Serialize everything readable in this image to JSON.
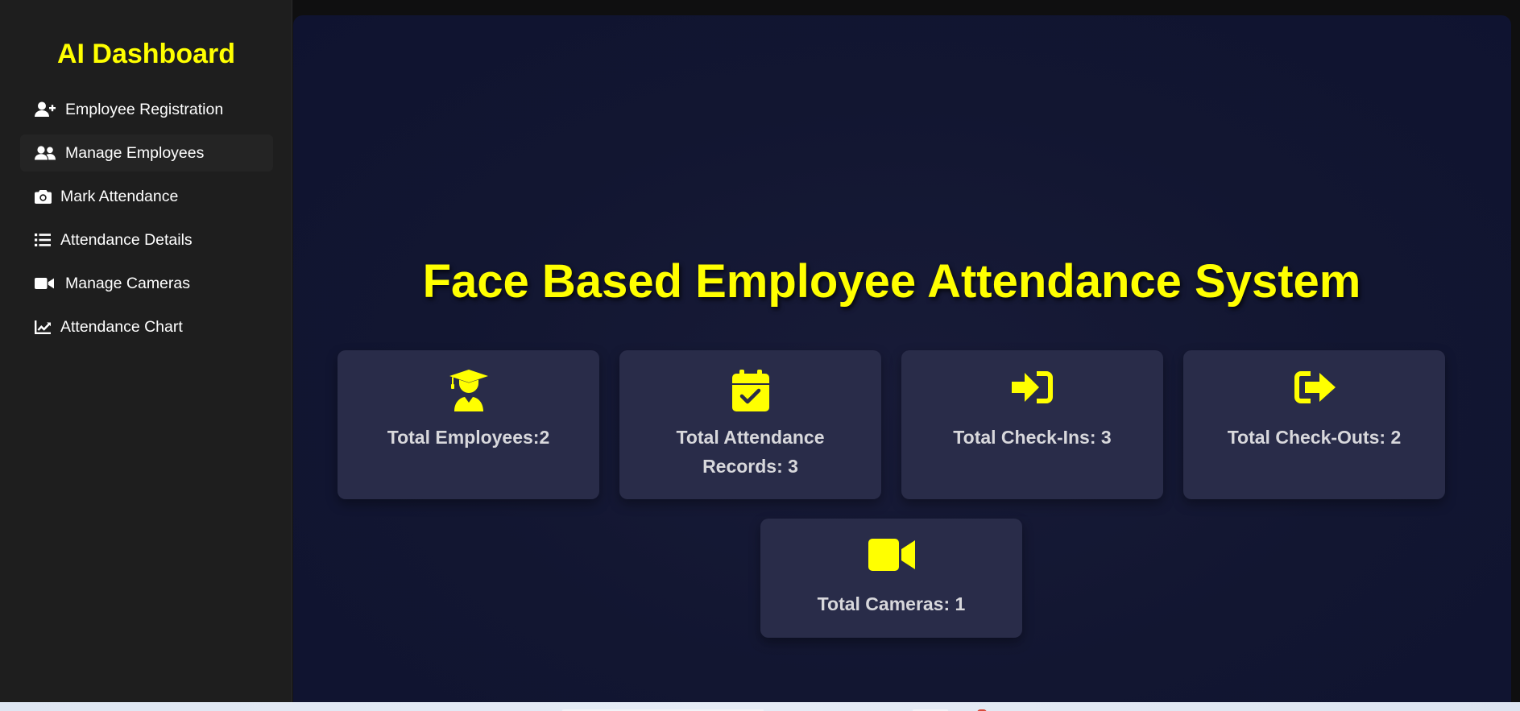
{
  "sidebar": {
    "title": "AI Dashboard",
    "items": [
      {
        "label": "Employee Registration",
        "icon": "user-plus-icon"
      },
      {
        "label": "Manage Employees",
        "icon": "users-icon",
        "active": true
      },
      {
        "label": "Mark Attendance",
        "icon": "camera-icon"
      },
      {
        "label": "Attendance Details",
        "icon": "list-icon"
      },
      {
        "label": "Manage Cameras",
        "icon": "video-camera-icon"
      },
      {
        "label": "Attendance Chart",
        "icon": "line-chart-icon"
      }
    ]
  },
  "main": {
    "title": "Face Based Employee Attendance System",
    "cards": [
      {
        "label": "Total Employees:2",
        "icon": "graduate-user-icon"
      },
      {
        "label": "Total Attendance Records: 3",
        "icon": "calendar-check-icon"
      },
      {
        "label": "Total Check-Ins: 3",
        "icon": "sign-in-icon"
      },
      {
        "label": "Total Check-Outs: 2",
        "icon": "sign-out-icon"
      },
      {
        "label": "Total Cameras: 1",
        "icon": "video-camera-icon"
      }
    ]
  },
  "colors": {
    "accent": "#ffff00",
    "sidebar_bg": "#1e1e1e",
    "main_bg": "#121631",
    "card_bg": "#292c49",
    "card_text": "#d8d8dc"
  }
}
